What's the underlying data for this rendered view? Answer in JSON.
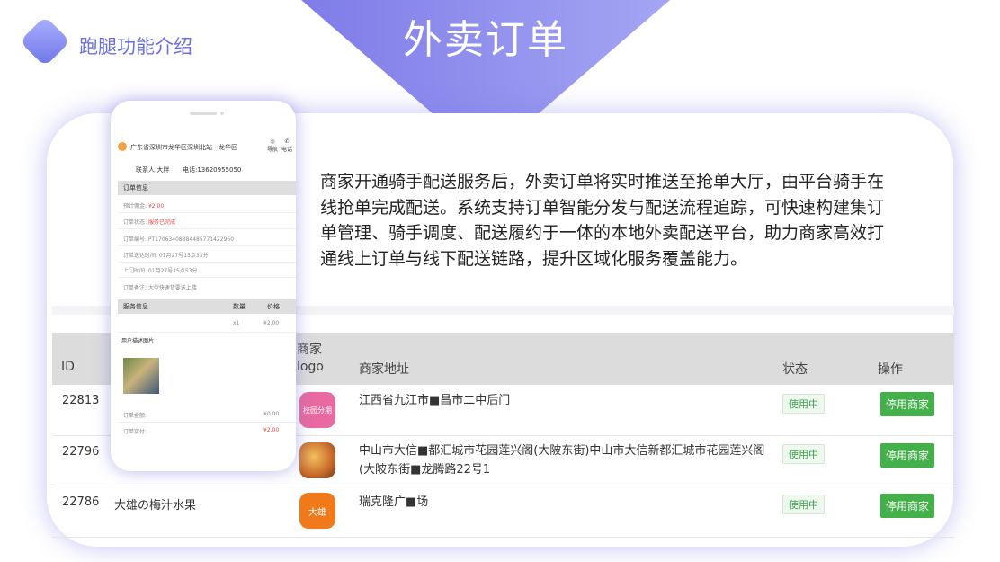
{
  "header": {
    "section_title": "跑腿功能介绍",
    "banner_title": "外卖订单"
  },
  "description": "商家开通骑手配送服务后，外卖订单将实时推送至抢单大厅，由平台骑手在线抢单完成配送。系统支持订单智能分发与配送流程追踪，可快速构建集订单管理、骑手调度、配送履约于一体的本地外卖配送平台，助力商家高效打通线上订单与线下配送链路，提升区域化服务覆盖能力。",
  "table": {
    "headers": {
      "id": "ID",
      "logo_line1": "商家",
      "logo_line2": "logo",
      "address": "商家地址",
      "status": "状态",
      "action": "操作"
    },
    "rows": [
      {
        "id": "22813",
        "name": "",
        "logo_text": "校园分期",
        "logo_color": "#e86aa0",
        "address": "江西省九江市■昌市二中后门",
        "status": "使用中",
        "action": "停用商家"
      },
      {
        "id": "22796",
        "name": "",
        "logo_text": "",
        "logo_color": "#c86a2a",
        "address": "中山市大信■都汇城市花园莲兴阁(大陂东街)中山市大信新都汇城市花园莲兴阁(大陂东街■龙腾路22号1",
        "status": "使用中",
        "action": "停用商家"
      },
      {
        "id": "22786",
        "name": "大雄の梅汁水果",
        "logo_text": "大雄",
        "logo_color": "#f07a1a",
        "address": "瑞克隆广■场",
        "status": "使用中",
        "action": "停用商家"
      }
    ]
  },
  "phone": {
    "address": "广东省深圳市龙华区深圳北站 - 龙华区",
    "nav_label": "导航",
    "call_label": "电话",
    "contact": "联系人:大胖",
    "phone_number": "电话:13620955050",
    "order_info_title": "订单信息",
    "commission": "预计佣金:",
    "commission_value": "¥2.00",
    "order_status": "订单状态:",
    "order_status_value": "服务已完成",
    "order_number": "订单编号: PT17063408384485771422960",
    "delivery_time": "订单送达时间: 01月27号15点33分",
    "pickup_time": "上门时间: 01月27号15点53分",
    "remark": "订单备注: 大型快速货要送上楼",
    "service_title": "服务信息",
    "qty_label": "数量",
    "price_label": "价格",
    "qty_value": "x1",
    "price_value": "¥2.00",
    "photos_label": "用户描述图片",
    "order_amount_label": "订单金额:",
    "order_amount_value": "¥0.00",
    "paid_label": "订单实付:",
    "paid_value": "¥2.00"
  },
  "colors": {
    "accent": "#6f74e8",
    "button_green": "#43b04a",
    "status_green": "#3aa34a"
  }
}
